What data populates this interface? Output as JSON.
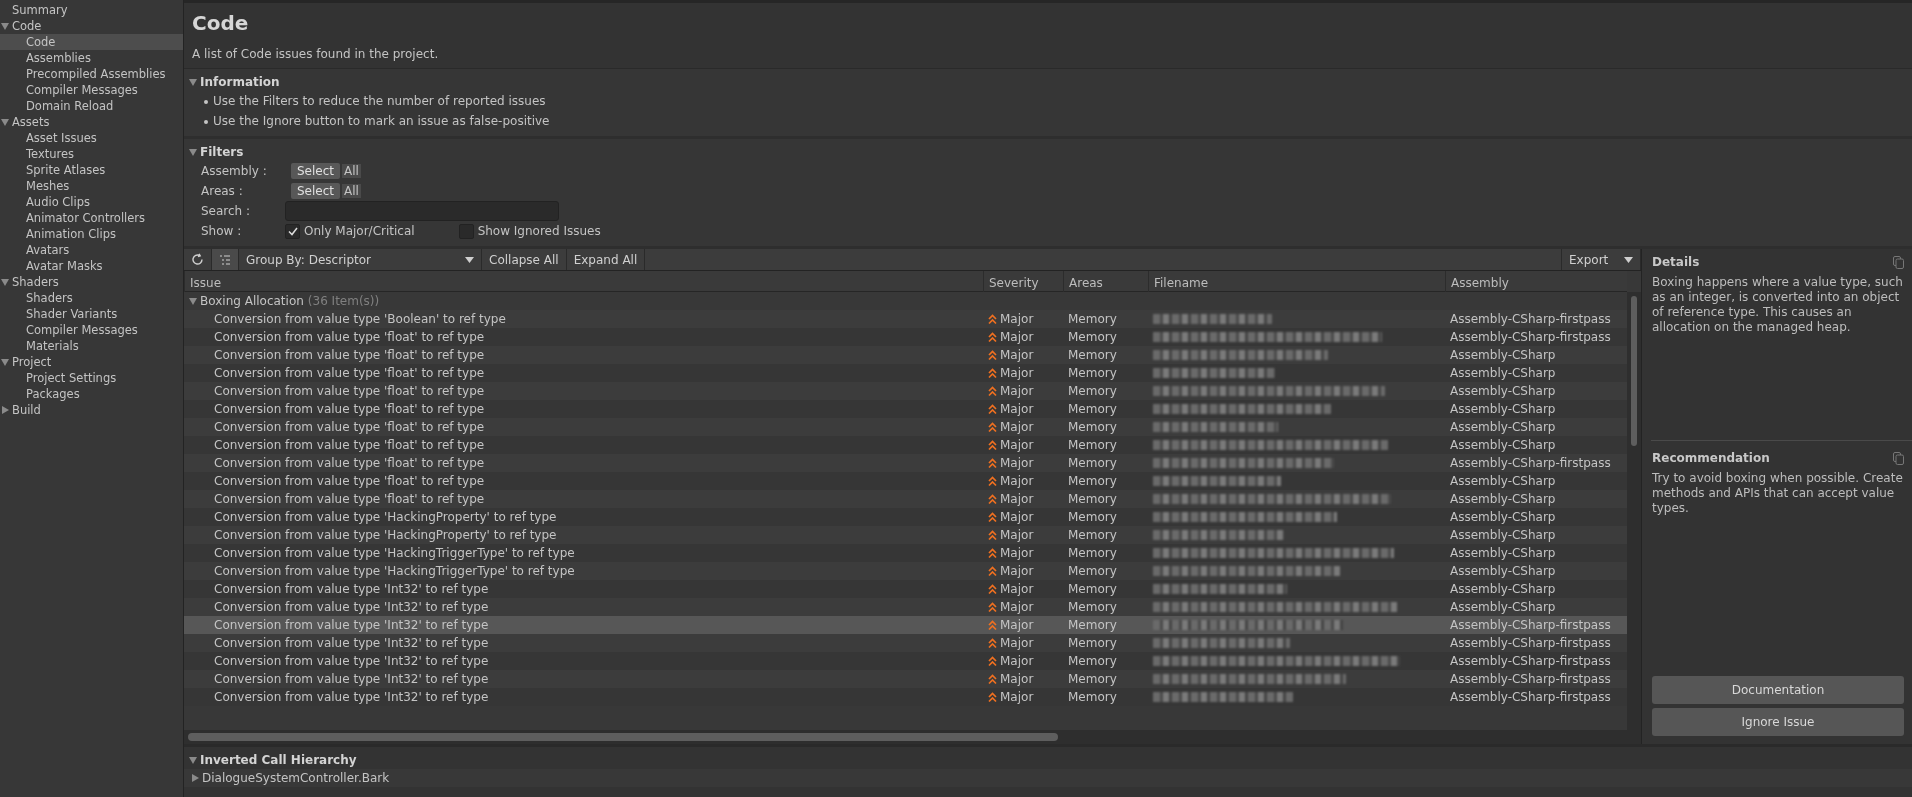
{
  "sidebar": {
    "items": [
      {
        "label": "Summary",
        "selected": false
      },
      {
        "label": "Code",
        "expanded": true,
        "children": [
          {
            "label": "Code",
            "selected": true
          },
          {
            "label": "Assemblies",
            "selected": false
          },
          {
            "label": "Precompiled Assemblies",
            "selected": false
          },
          {
            "label": "Compiler Messages",
            "selected": false
          },
          {
            "label": "Domain Reload",
            "selected": false
          }
        ]
      },
      {
        "label": "Assets",
        "expanded": true,
        "children": [
          {
            "label": "Asset Issues",
            "selected": false
          },
          {
            "label": "Textures",
            "selected": false
          },
          {
            "label": "Sprite Atlases",
            "selected": false
          },
          {
            "label": "Meshes",
            "selected": false
          },
          {
            "label": "Audio Clips",
            "selected": false
          },
          {
            "label": "Animator Controllers",
            "selected": false
          },
          {
            "label": "Animation Clips",
            "selected": false
          },
          {
            "label": "Avatars",
            "selected": false
          },
          {
            "label": "Avatar Masks",
            "selected": false
          }
        ]
      },
      {
        "label": "Shaders",
        "expanded": true,
        "children": [
          {
            "label": "Shaders",
            "selected": false
          },
          {
            "label": "Shader Variants",
            "selected": false
          },
          {
            "label": "Compiler Messages",
            "selected": false
          },
          {
            "label": "Materials",
            "selected": false
          }
        ]
      },
      {
        "label": "Project",
        "expanded": true,
        "children": [
          {
            "label": "Project Settings",
            "selected": false
          },
          {
            "label": "Packages",
            "selected": false
          }
        ]
      },
      {
        "label": "Build",
        "expanded": false
      }
    ]
  },
  "header": {
    "title": "Code",
    "description": "A list of Code issues found in the project."
  },
  "information": {
    "title": "Information",
    "expanded": true,
    "lines": [
      "Use the Filters to reduce the number of reported issues",
      "Use the Ignore button to mark an issue as false-positive"
    ]
  },
  "filters": {
    "title": "Filters",
    "expanded": true,
    "assembly": {
      "label": "Assembly :",
      "button": "Select",
      "value": "All"
    },
    "areas": {
      "label": "Areas :",
      "button": "Select",
      "value": "All"
    },
    "search": {
      "label": "Search :"
    },
    "show": {
      "label": "Show :",
      "options": [
        {
          "label": "Only Major/Critical",
          "checked": true
        },
        {
          "label": "Show Ignored Issues",
          "checked": false
        }
      ]
    }
  },
  "toolbar": {
    "group_by": "Group By: Descriptor",
    "collapse": "Collapse All",
    "expand": "Expand All",
    "export": "Export"
  },
  "table": {
    "columns": [
      "Issue",
      "Severity",
      "Areas",
      "Filename",
      "Assembly"
    ],
    "group": {
      "label": "Boxing Allocation",
      "count": "(36 Item(s))",
      "expanded": true
    },
    "rows": [
      {
        "issue": "Conversion from value type 'Boolean' to ref type",
        "severity": "Major",
        "area": "Memory",
        "assembly": "Assembly-CSharp-firstpass",
        "selected": false
      },
      {
        "issue": "Conversion from value type 'float' to ref type",
        "severity": "Major",
        "area": "Memory",
        "assembly": "Assembly-CSharp-firstpass",
        "selected": false
      },
      {
        "issue": "Conversion from value type 'float' to ref type",
        "severity": "Major",
        "area": "Memory",
        "assembly": "Assembly-CSharp",
        "selected": false
      },
      {
        "issue": "Conversion from value type 'float' to ref type",
        "severity": "Major",
        "area": "Memory",
        "assembly": "Assembly-CSharp",
        "selected": false
      },
      {
        "issue": "Conversion from value type 'float' to ref type",
        "severity": "Major",
        "area": "Memory",
        "assembly": "Assembly-CSharp",
        "selected": false
      },
      {
        "issue": "Conversion from value type 'float' to ref type",
        "severity": "Major",
        "area": "Memory",
        "assembly": "Assembly-CSharp",
        "selected": false
      },
      {
        "issue": "Conversion from value type 'float' to ref type",
        "severity": "Major",
        "area": "Memory",
        "assembly": "Assembly-CSharp",
        "selected": false
      },
      {
        "issue": "Conversion from value type 'float' to ref type",
        "severity": "Major",
        "area": "Memory",
        "assembly": "Assembly-CSharp",
        "selected": false
      },
      {
        "issue": "Conversion from value type 'float' to ref type",
        "severity": "Major",
        "area": "Memory",
        "assembly": "Assembly-CSharp-firstpass",
        "selected": false
      },
      {
        "issue": "Conversion from value type 'float' to ref type",
        "severity": "Major",
        "area": "Memory",
        "assembly": "Assembly-CSharp",
        "selected": false
      },
      {
        "issue": "Conversion from value type 'float' to ref type",
        "severity": "Major",
        "area": "Memory",
        "assembly": "Assembly-CSharp",
        "selected": false
      },
      {
        "issue": "Conversion from value type 'HackingProperty' to ref type",
        "severity": "Major",
        "area": "Memory",
        "assembly": "Assembly-CSharp",
        "selected": false
      },
      {
        "issue": "Conversion from value type 'HackingProperty' to ref type",
        "severity": "Major",
        "area": "Memory",
        "assembly": "Assembly-CSharp",
        "selected": false
      },
      {
        "issue": "Conversion from value type 'HackingTriggerType' to ref type",
        "severity": "Major",
        "area": "Memory",
        "assembly": "Assembly-CSharp",
        "selected": false
      },
      {
        "issue": "Conversion from value type 'HackingTriggerType' to ref type",
        "severity": "Major",
        "area": "Memory",
        "assembly": "Assembly-CSharp",
        "selected": false
      },
      {
        "issue": "Conversion from value type 'Int32' to ref type",
        "severity": "Major",
        "area": "Memory",
        "assembly": "Assembly-CSharp",
        "selected": false
      },
      {
        "issue": "Conversion from value type 'Int32' to ref type",
        "severity": "Major",
        "area": "Memory",
        "assembly": "Assembly-CSharp",
        "selected": false
      },
      {
        "issue": "Conversion from value type 'Int32' to ref type",
        "severity": "Major",
        "area": "Memory",
        "assembly": "Assembly-CSharp-firstpass",
        "selected": true
      },
      {
        "issue": "Conversion from value type 'Int32' to ref type",
        "severity": "Major",
        "area": "Memory",
        "assembly": "Assembly-CSharp-firstpass",
        "selected": false
      },
      {
        "issue": "Conversion from value type 'Int32' to ref type",
        "severity": "Major",
        "area": "Memory",
        "assembly": "Assembly-CSharp-firstpass",
        "selected": false
      },
      {
        "issue": "Conversion from value type 'Int32' to ref type",
        "severity": "Major",
        "area": "Memory",
        "assembly": "Assembly-CSharp-firstpass",
        "selected": false
      },
      {
        "issue": "Conversion from value type 'Int32' to ref type",
        "severity": "Major",
        "area": "Memory",
        "assembly": "Assembly-CSharp-firstpass",
        "selected": false
      }
    ]
  },
  "details": {
    "title": "Details",
    "text": "Boxing happens where a value type, such as an integer, is converted into an object of reference type. This causes an allocation on the managed heap."
  },
  "recommendation": {
    "title": "Recommendation",
    "text": "Try to avoid boxing when possible. Create methods and APIs that can accept value types."
  },
  "actions": [
    "Documentation",
    "Ignore Issue"
  ],
  "call_hierarchy": {
    "title": "Inverted Call Hierarchy",
    "expanded": true,
    "items": [
      {
        "label": "DialogueSystemController.Bark",
        "expanded": false
      }
    ]
  }
}
